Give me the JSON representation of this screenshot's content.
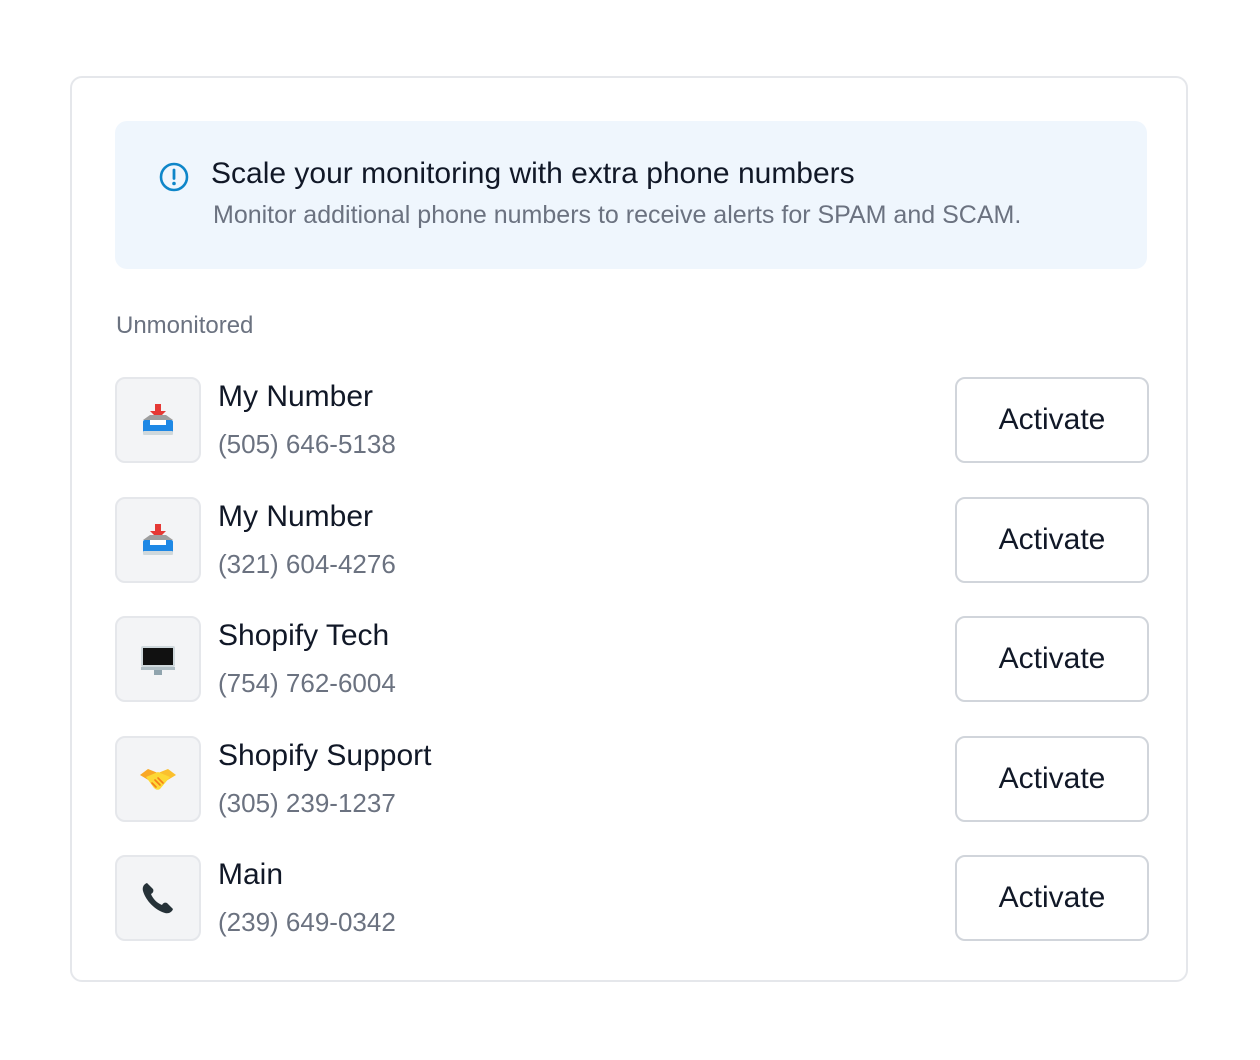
{
  "banner": {
    "icon": "info-circle-icon",
    "accent_color": "#0e86c9",
    "background_color": "#eff6fd",
    "title": "Scale your monitoring with extra phone numbers",
    "subtitle": "Monitor additional phone numbers to receive alerts for SPAM and SCAM."
  },
  "section": {
    "label": "Unmonitored"
  },
  "numbers": [
    {
      "icon": "inbox-tray-icon",
      "name": "My Number",
      "phone": "(505) 646-5138",
      "action": "Activate"
    },
    {
      "icon": "inbox-tray-icon",
      "name": "My Number",
      "phone": "(321) 604-4276",
      "action": "Activate"
    },
    {
      "icon": "desktop-computer-icon",
      "name": "Shopify Tech",
      "phone": "(754) 762-6004",
      "action": "Activate"
    },
    {
      "icon": "handshake-icon",
      "name": "Shopify Support",
      "phone": "(305) 239-1237",
      "action": "Activate"
    },
    {
      "icon": "telephone-receiver-icon",
      "name": "Main",
      "phone": "(239) 649-0342",
      "action": "Activate"
    }
  ]
}
